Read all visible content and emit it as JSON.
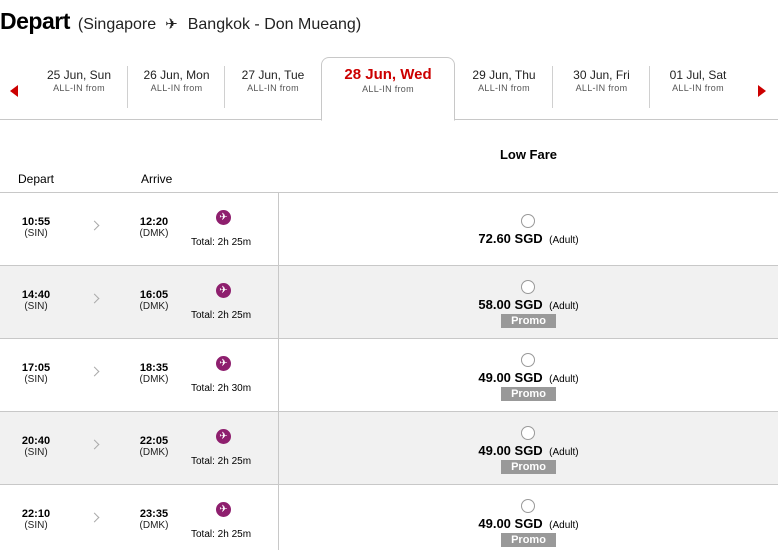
{
  "header": {
    "title": "Depart",
    "route_open": "(Singapore",
    "route_close": "Bangkok - Don Mueang)"
  },
  "dates": [
    {
      "date": "25 Jun, Sun",
      "sub": "ALL-IN from"
    },
    {
      "date": "26 Jun, Mon",
      "sub": "ALL-IN from"
    },
    {
      "date": "27 Jun, Tue",
      "sub": "ALL-IN from"
    },
    {
      "date": "28 Jun, Wed",
      "sub": "ALL-IN from",
      "active": true
    },
    {
      "date": "29 Jun, Thu",
      "sub": "ALL-IN from"
    },
    {
      "date": "30 Jun, Fri",
      "sub": "ALL-IN from"
    },
    {
      "date": "01 Jul, Sat",
      "sub": "ALL-IN from"
    }
  ],
  "table": {
    "fare_header": "Low Fare",
    "depart_header": "Depart",
    "arrive_header": "Arrive"
  },
  "flights": [
    {
      "depart_time": "10:55",
      "depart_code": "(SIN)",
      "arrive_time": "12:20",
      "arrive_code": "(DMK)",
      "total": "Total: 2h 25m",
      "price": "72.60 SGD",
      "pax": "(Adult)",
      "promo": ""
    },
    {
      "depart_time": "14:40",
      "depart_code": "(SIN)",
      "arrive_time": "16:05",
      "arrive_code": "(DMK)",
      "total": "Total: 2h 25m",
      "price": "58.00 SGD",
      "pax": "(Adult)",
      "promo": "Promo"
    },
    {
      "depart_time": "17:05",
      "depart_code": "(SIN)",
      "arrive_time": "18:35",
      "arrive_code": "(DMK)",
      "total": "Total: 2h 30m",
      "price": "49.00 SGD",
      "pax": "(Adult)",
      "promo": "Promo"
    },
    {
      "depart_time": "20:40",
      "depart_code": "(SIN)",
      "arrive_time": "22:05",
      "arrive_code": "(DMK)",
      "total": "Total: 2h 25m",
      "price": "49.00 SGD",
      "pax": "(Adult)",
      "promo": "Promo"
    },
    {
      "depart_time": "22:10",
      "depart_code": "(SIN)",
      "arrive_time": "23:35",
      "arrive_code": "(DMK)",
      "total": "Total: 2h 25m",
      "price": "49.00 SGD",
      "pax": "(Adult)",
      "promo": "Promo"
    }
  ],
  "colors": {
    "accent": "#cc0000",
    "airline_icon": "#8e1f6e",
    "promo_badge": "#999999",
    "alt_row": "#f1f1f1"
  },
  "icons": {
    "prev": "triangle-left-icon",
    "next": "triangle-right-icon",
    "route": "airplane-icon",
    "flight": "airline-logo-icon",
    "expand": "chevron-right-icon",
    "select": "radio-icon"
  }
}
